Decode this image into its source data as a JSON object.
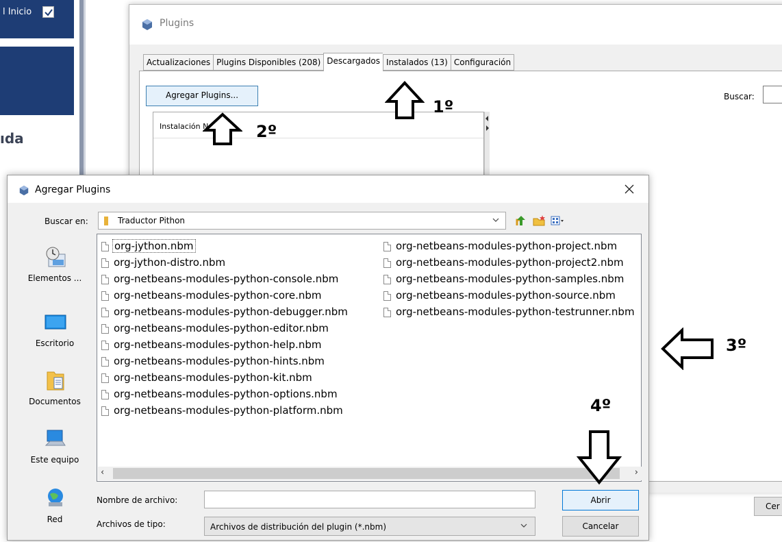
{
  "background": {
    "label_inicio": "l Inicio",
    "label_ada": "ıda"
  },
  "plugins_window": {
    "title": "Plugins",
    "tabs": [
      {
        "label": "Actualizaciones"
      },
      {
        "label": "Plugins Disponibles (208)"
      },
      {
        "label": "Descargados",
        "active": true
      },
      {
        "label": "Instalados (13)"
      },
      {
        "label": "Configuración"
      }
    ],
    "add_plugins_label": "Agregar Plugins...",
    "search_label": "Buscar:",
    "list_header": "Instalación   Nombre",
    "cancel_label": "Cer"
  },
  "dialog": {
    "title": "Agregar Plugins",
    "look_in_label": "Buscar en:",
    "look_in_value": "Traductor Pithon",
    "places": [
      {
        "label": "Elementos ...",
        "icon": "recent-items-icon"
      },
      {
        "label": "Escritorio",
        "icon": "desktop-icon"
      },
      {
        "label": "Documentos",
        "icon": "documents-icon"
      },
      {
        "label": "Este equipo",
        "icon": "computer-icon"
      },
      {
        "label": "Red",
        "icon": "network-icon"
      }
    ],
    "files_col1": [
      "org-jython.nbm",
      "org-jython-distro.nbm",
      "org-netbeans-modules-python-console.nbm",
      "org-netbeans-modules-python-core.nbm",
      "org-netbeans-modules-python-debugger.nbm",
      "org-netbeans-modules-python-editor.nbm",
      "org-netbeans-modules-python-help.nbm",
      "org-netbeans-modules-python-hints.nbm",
      "org-netbeans-modules-python-kit.nbm",
      "org-netbeans-modules-python-options.nbm",
      "org-netbeans-modules-python-platform.nbm"
    ],
    "files_col2": [
      "org-netbeans-modules-python-project.nbm",
      "org-netbeans-modules-python-project2.nbm",
      "org-netbeans-modules-python-samples.nbm",
      "org-netbeans-modules-python-source.nbm",
      "org-netbeans-modules-python-testrunner.nbm"
    ],
    "file_name_label": "Nombre de archivo:",
    "file_name_value": "",
    "file_type_label": "Archivos de tipo:",
    "file_type_value": "Archivos de distribución del plugin (*.nbm)",
    "open_label": "Abrir",
    "cancel_label": "Cancelar"
  },
  "annotations": {
    "step1": "1º",
    "step2": "2º",
    "step3": "3º",
    "step4": "4º"
  }
}
